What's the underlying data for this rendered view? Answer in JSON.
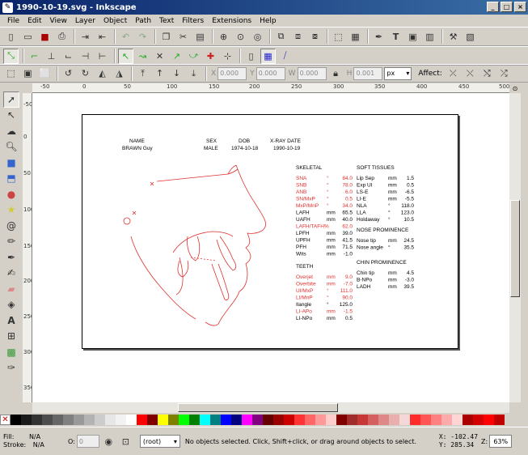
{
  "window": {
    "title": "1990-10-19.svg - Inkscape",
    "buttons": [
      "_",
      "□",
      "×"
    ]
  },
  "menu": [
    "File",
    "Edit",
    "View",
    "Layer",
    "Object",
    "Path",
    "Text",
    "Filters",
    "Extensions",
    "Help"
  ],
  "toolbar3": {
    "x_label": "X",
    "x_value": "0.000",
    "y_label": "Y",
    "y_value": "0.000",
    "w_label": "W",
    "w_value": "0.000",
    "h_label": "H",
    "h_value": "0.001",
    "unit": "px",
    "affect_label": "Affect:"
  },
  "rulers": {
    "h": [
      "-50",
      "0",
      "50",
      "100",
      "150",
      "200",
      "250",
      "300",
      "350",
      "400",
      "450",
      "500"
    ],
    "v": [
      "-50",
      "0",
      "50",
      "100",
      "150",
      "200",
      "250",
      "300",
      "350"
    ]
  },
  "document": {
    "header": {
      "name_label": "NAME",
      "name_value": "BRAWN Guy",
      "sex_label": "SEX",
      "sex_value": "MALE",
      "dob_label": "DOB",
      "dob_value": "1974-10-18",
      "xray_label": "X-RAY DATE",
      "xray_value": "1990-10-19"
    },
    "skeletal": {
      "title": "SKELETAL",
      "rows": [
        {
          "label": "SNA",
          "unit": "°",
          "value": "84.0",
          "red": true
        },
        {
          "label": "SNB",
          "unit": "°",
          "value": "78.0",
          "red": true
        },
        {
          "label": "ANB",
          "unit": "°",
          "value": "6.0",
          "red": true
        },
        {
          "label": "SN/MxP",
          "unit": "°",
          "value": "0.5",
          "red": true
        },
        {
          "label": "MxP/MnP",
          "unit": "°",
          "value": "34.0",
          "red": true
        },
        {
          "label": "LAFH",
          "unit": "mm",
          "value": "65.5",
          "red": false
        },
        {
          "label": "UAFH",
          "unit": "mm",
          "value": "40.0",
          "red": false
        },
        {
          "label": "LAFH/TAFH%",
          "unit": "",
          "value": "62.0",
          "red": true
        },
        {
          "label": "LPFH",
          "unit": "mm",
          "value": "39.0",
          "red": false
        },
        {
          "label": "UPFH",
          "unit": "mm",
          "value": "41.5",
          "red": false
        },
        {
          "label": "PFH",
          "unit": "mm",
          "value": "71.5",
          "red": false
        },
        {
          "label": "Wits",
          "unit": "mm",
          "value": "-1.0",
          "red": false
        }
      ]
    },
    "teeth": {
      "title": "TEETH",
      "rows": [
        {
          "label": "Overjet",
          "unit": "mm",
          "value": "9.0",
          "red": true
        },
        {
          "label": "Overbite",
          "unit": "mm",
          "value": "-7.0",
          "red": true
        },
        {
          "label": "UI/MxP",
          "unit": "°",
          "value": "111.0",
          "red": true
        },
        {
          "label": "LI/MnP",
          "unit": "°",
          "value": "90.0",
          "red": true
        },
        {
          "label": "Ilangle",
          "unit": "°",
          "value": "125.0",
          "red": false
        },
        {
          "label": "LI-APo",
          "unit": "mm",
          "value": "-1.5",
          "red": true
        },
        {
          "label": "LI-NPo",
          "unit": "mm",
          "value": "0.5",
          "red": false
        }
      ]
    },
    "soft": {
      "title": "SOFT TISSUES",
      "rows": [
        {
          "label": "Lip Sep",
          "unit": "mm",
          "value": "1.5"
        },
        {
          "label": "Exp UI",
          "unit": "mm",
          "value": "0.5"
        },
        {
          "label": "LS-E",
          "unit": "mm",
          "value": "-6.5"
        },
        {
          "label": "LI-E",
          "unit": "mm",
          "value": "-5.5"
        },
        {
          "label": "NLA",
          "unit": "°",
          "value": "118.0"
        },
        {
          "label": "LLA",
          "unit": "°",
          "value": "123.0"
        },
        {
          "label": "Holdaway",
          "unit": "°",
          "value": "10.5"
        }
      ]
    },
    "nose": {
      "title": "NOSE PROMINENCE",
      "rows": [
        {
          "label": "Nose tip",
          "unit": "mm",
          "value": "24.5"
        },
        {
          "label": "Nose angle",
          "unit": "°",
          "value": "35.5"
        }
      ]
    },
    "chin": {
      "title": "CHIN PROMINENCE",
      "rows": [
        {
          "label": "Chin tip",
          "unit": "mm",
          "value": "4.5"
        },
        {
          "label": "B-NPo",
          "unit": "mm",
          "value": "-3.0"
        },
        {
          "label": "LADH",
          "unit": "mm",
          "value": "39.5"
        }
      ]
    }
  },
  "palette": [
    "#000000",
    "#1a1a1a",
    "#333333",
    "#4d4d4d",
    "#666666",
    "#808080",
    "#999999",
    "#b3b3b3",
    "#cccccc",
    "#e6e6e6",
    "#f2f2f2",
    "#ffffff",
    "#ff0000",
    "#800000",
    "#ffff00",
    "#808000",
    "#00ff00",
    "#008000",
    "#00ffff",
    "#008080",
    "#0000ff",
    "#000080",
    "#ff00ff",
    "#800080",
    "#660000",
    "#990000",
    "#cc0000",
    "#ff3333",
    "#ff6666",
    "#ff9999",
    "#ffcccc",
    "#800000",
    "#a02c2c",
    "#c83737",
    "#d35f5f",
    "#de8787",
    "#e9afaf",
    "#f4d7d7",
    "#ff2a2a",
    "#ff5555",
    "#ff8080",
    "#ffaaaa",
    "#ffd5d5",
    "#aa0000",
    "#d40000",
    "#ff0000",
    "#c00000"
  ],
  "status": {
    "fill_label": "Fill:",
    "fill_value": "N/A",
    "stroke_label": "Stroke:",
    "stroke_value": "N/A",
    "opacity_label": "O:",
    "opacity_value": "0",
    "layer": "(root)",
    "message": "No objects selected. Click, Shift+click, or drag around objects to select.",
    "x": "X: -102.47",
    "y": "Y:  285.34",
    "zoom_label": "Z:",
    "zoom_value": "63%"
  }
}
